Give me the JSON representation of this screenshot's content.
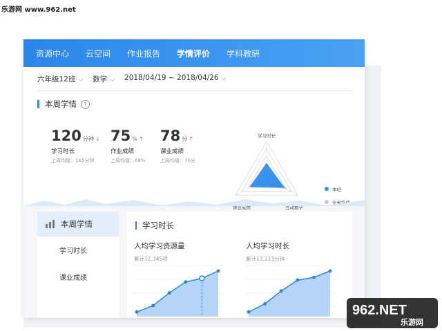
{
  "site": {
    "mark": "乐游网 www.962.net"
  },
  "nav": {
    "items": [
      {
        "label": "资源中心"
      },
      {
        "label": "云空间"
      },
      {
        "label": "作业报告"
      },
      {
        "label": "学情评价"
      },
      {
        "label": "学科教研"
      }
    ],
    "active_index": 3
  },
  "filters": {
    "class": "六年级12班",
    "subject": "数学",
    "date_range": "2018/04/19 ~ 2018/04/26"
  },
  "weekly": {
    "title": "本周学情",
    "help_icon": "question-circle-icon",
    "stats": [
      {
        "value": "120",
        "unit": "分钟",
        "trend": "↓",
        "label": "学习时长",
        "avg": "上周均值：165分钟"
      },
      {
        "value": "75",
        "unit": "%",
        "trend": "↑",
        "label": "作业成绩",
        "avg": "上周均值：68%"
      },
      {
        "value": "78",
        "unit": "分",
        "trend": "↑",
        "label": "课业成绩",
        "avg": "上周均值：70分"
      }
    ]
  },
  "radar": {
    "axes": [
      "学习时长",
      "课业成绩",
      "互动教学"
    ],
    "series": [
      {
        "name": "本班",
        "values": [
          0.4,
          0.55,
          0.58
        ],
        "color": "#2f8cf0"
      },
      {
        "name": "全省均值",
        "values": [
          0.2,
          0.35,
          0.7
        ],
        "color": "#c8c8c8"
      }
    ]
  },
  "sidebar": {
    "icon": "bar-chart-icon",
    "active_label": "本周学情",
    "items": [
      {
        "label": "学习时长"
      },
      {
        "label": "课业成绩"
      }
    ]
  },
  "main": {
    "title": "学习时长",
    "charts": [
      {
        "title": "人均学习资源量",
        "subtitle": "累计12,345项",
        "values": [
          5,
          12,
          26,
          38,
          42,
          50
        ],
        "highlight_index": 4
      },
      {
        "title": "人均学习时长",
        "subtitle": "累计13,213分钟",
        "values": [
          5,
          14,
          28,
          40,
          43,
          50
        ],
        "highlight_index": -1
      }
    ]
  },
  "watermark": {
    "text": "962.NET",
    "subtext": "乐游网"
  },
  "colors": {
    "accent": "#2b86e9",
    "up": "#e55c4a",
    "down": "#4aa1f4"
  }
}
